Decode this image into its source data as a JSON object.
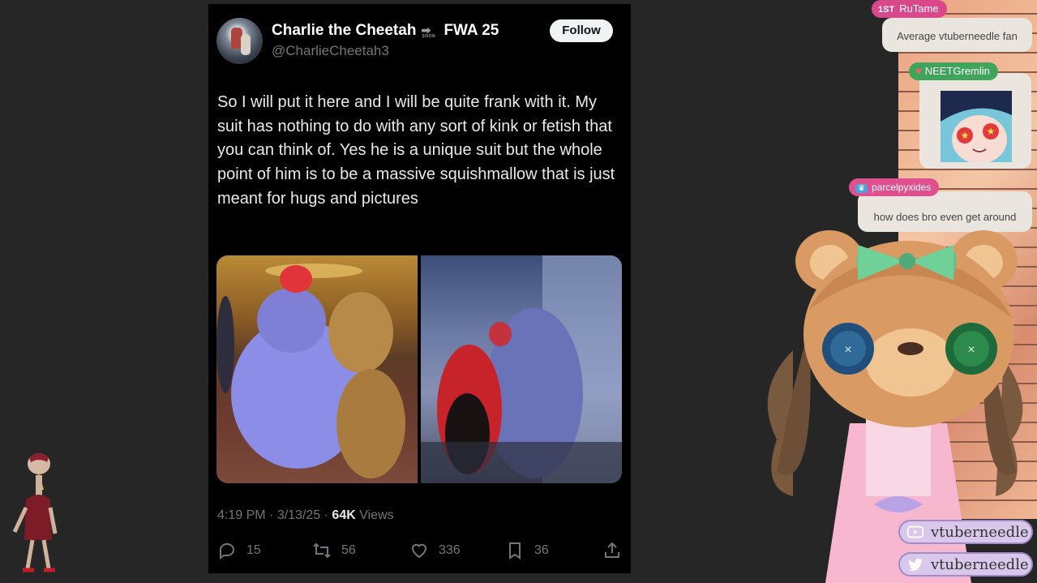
{
  "tweet": {
    "display_name": "Charlie the Cheetah",
    "soon_label": "SOON",
    "event_name": "FWA 25",
    "handle": "@CharlieCheetah3",
    "follow_label": "Follow",
    "text": "So I will put it here and I will be quite frank with it. My suit has nothing to do with any sort of kink or fetish that you can think of. Yes he is a unique suit but the whole point of him is to be a massive squishmallow that is just meant for hugs and pictures",
    "time": "4:19 PM",
    "date": "3/13/25",
    "views_count": "64K",
    "views_label": "Views",
    "stats": {
      "replies": "15",
      "reposts": "56",
      "likes": "336",
      "bookmarks": "36"
    }
  },
  "chat": [
    {
      "badge": "1ST",
      "user": "RuTame",
      "message": "Average vtuberneedle fan",
      "color": "#d9488a"
    },
    {
      "user": "NEETGremlin",
      "message": "",
      "color": "#3ea55a"
    },
    {
      "user": "parcelpyxides",
      "message": "how does bro even get around",
      "color": "#e0508f"
    }
  ],
  "socials": {
    "youtube": "vtuberneedle",
    "twitter": "vtuberneedle"
  },
  "icons": [
    "soon-arrow-icon",
    "reply-icon",
    "repost-icon",
    "like-icon",
    "bookmark-icon",
    "share-icon",
    "heart-badge-icon",
    "crown-badge-icon",
    "youtube-icon",
    "twitter-icon"
  ]
}
